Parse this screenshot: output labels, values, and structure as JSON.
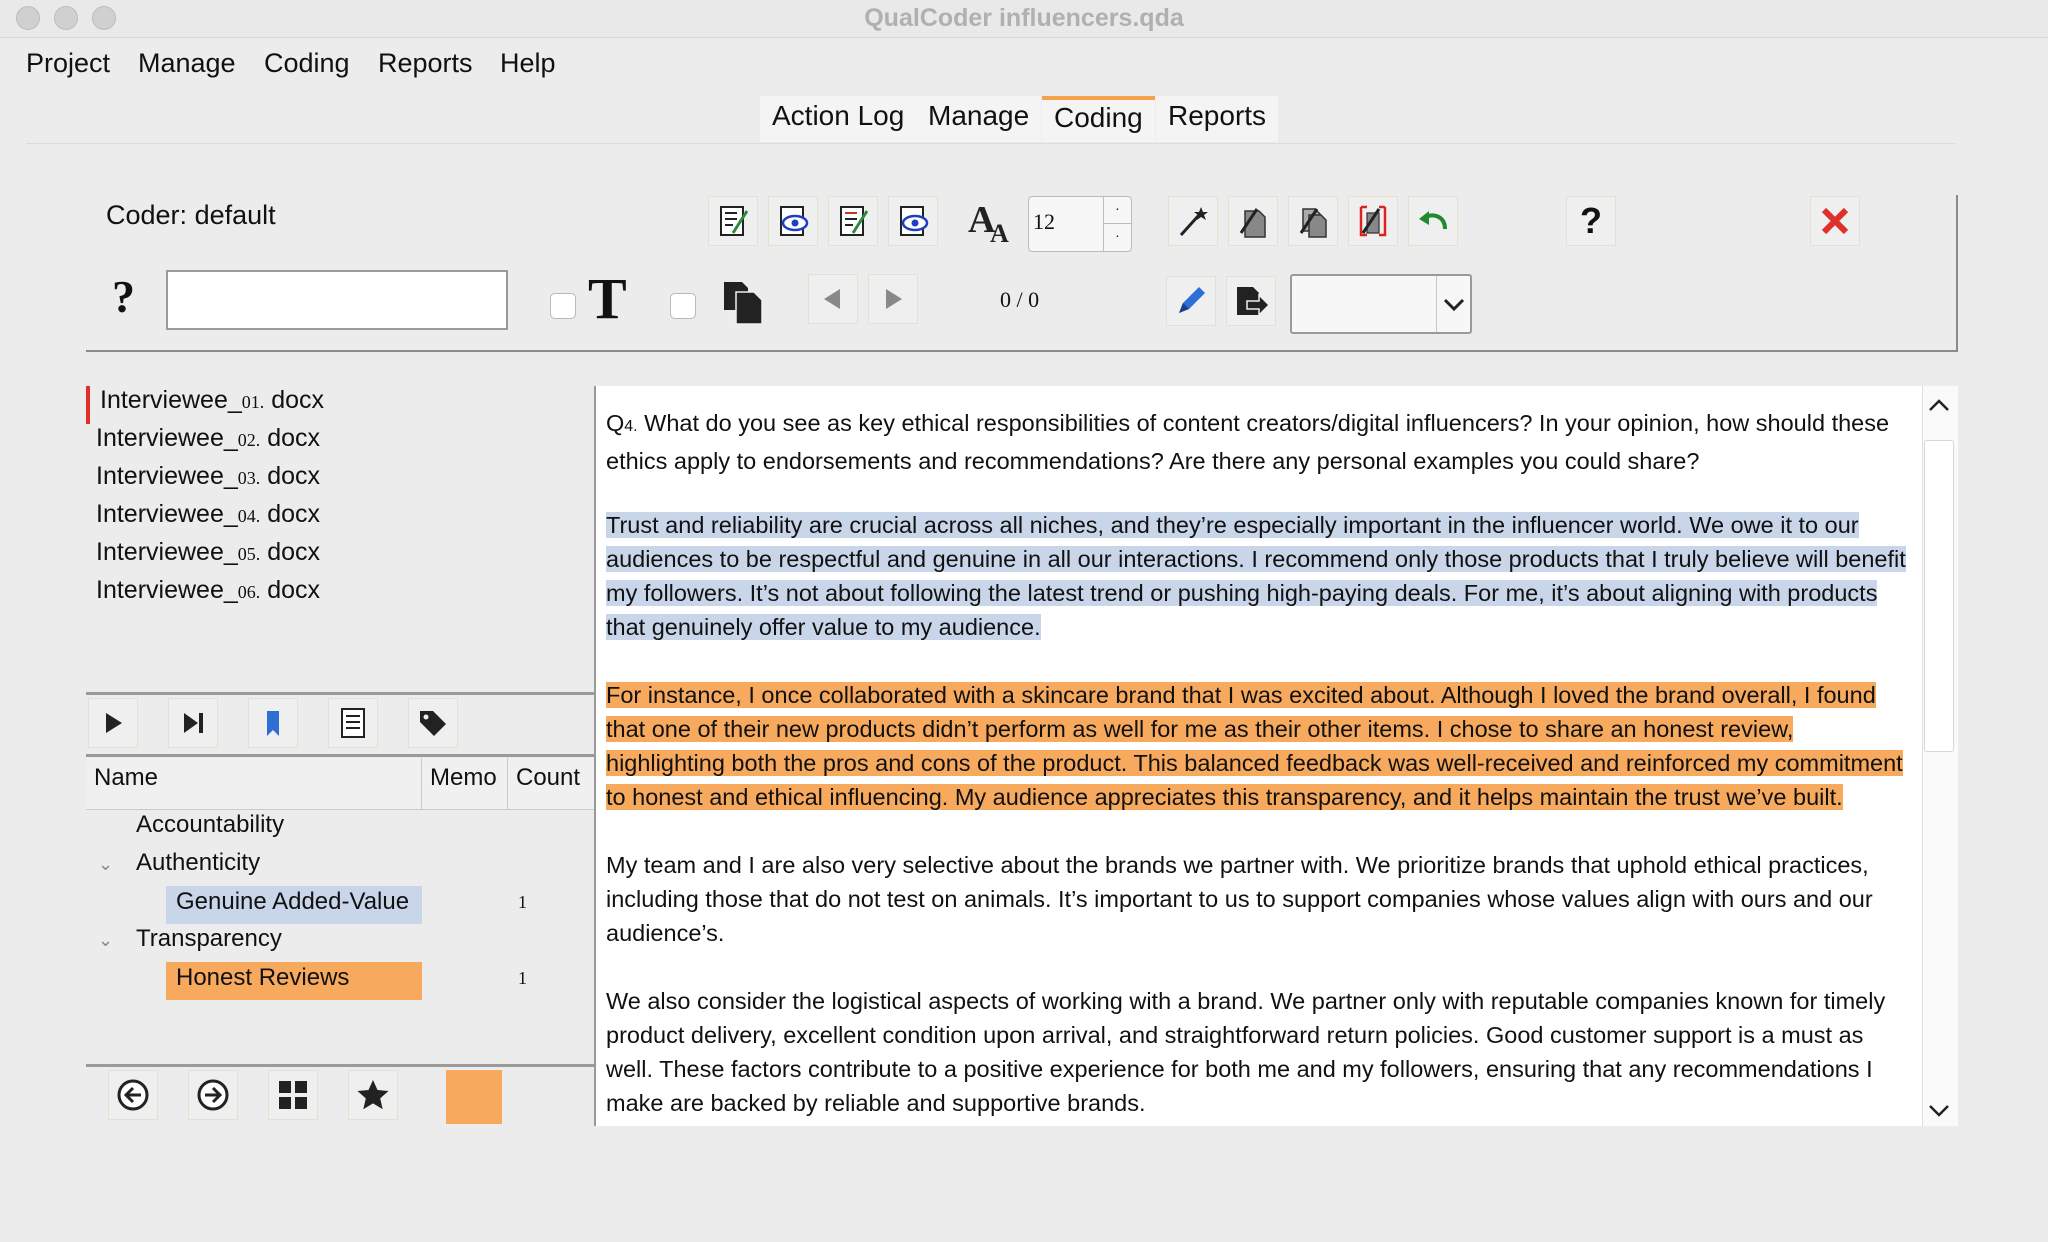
{
  "window": {
    "title": "QualCoder influencers.qda"
  },
  "menu": {
    "items": [
      "Project",
      "Manage",
      "Coding",
      "Reports",
      "Help"
    ]
  },
  "tabs": {
    "items": [
      {
        "label": "Action Log",
        "active": false
      },
      {
        "label": "Manage",
        "active": false
      },
      {
        "label": "Coding",
        "active": true
      },
      {
        "label": "Reports",
        "active": false
      }
    ]
  },
  "toolbar": {
    "coder_label": "Coder:",
    "coder_name": "default",
    "font_size": "12",
    "search_value": "",
    "search_help": "?",
    "help_label": "?",
    "page_counter": "0 / 0",
    "dropdown_value": "",
    "bold_t_label": "T"
  },
  "documents": {
    "items": [
      {
        "prefix": "Interviewee_",
        "num": "01.",
        "suffix": " docx"
      },
      {
        "prefix": "Interviewee_",
        "num": "02.",
        "suffix": " docx"
      },
      {
        "prefix": "Interviewee_",
        "num": "03.",
        "suffix": " docx"
      },
      {
        "prefix": "Interviewee_",
        "num": "04.",
        "suffix": " docx"
      },
      {
        "prefix": "Interviewee_",
        "num": "05.",
        "suffix": " docx"
      },
      {
        "prefix": "Interviewee_",
        "num": "06.",
        "suffix": " docx"
      }
    ]
  },
  "codes_tree": {
    "headers": {
      "name": "Name",
      "memo": "Memo",
      "count": "Count"
    },
    "rows": [
      {
        "name": "Accountability",
        "level": 0,
        "expandable": false,
        "count": ""
      },
      {
        "name": "Authenticity",
        "level": 0,
        "expandable": true,
        "count": ""
      },
      {
        "name": "Genuine Added-Value",
        "level": 1,
        "expandable": false,
        "count": "1",
        "color": "#c9d6ea"
      },
      {
        "name": "Transparency",
        "level": 0,
        "expandable": true,
        "count": ""
      },
      {
        "name": "Honest Reviews",
        "level": 1,
        "expandable": false,
        "count": "1",
        "color": "#f7aa5e"
      }
    ]
  },
  "colors": {
    "accent": "#f5a24a",
    "code_blue": "#c9d6ea",
    "code_orange": "#f7aa5e",
    "close_red": "#e0302a",
    "bookmark_blue": "#2e6fd6"
  },
  "text": {
    "q_prefix": "Q",
    "q_num": "4.",
    "q_body": "  What do you see as key ethical responsibilities of content creators/digital influencers? In your opinion, how should these ethics apply to endorsements and recommendations? Are there any personal examples you could share?",
    "p1": "Trust and reliability are crucial across all niches, and they’re especially important in the influencer world.  We owe it to our audiences to be respectful and genuine in all our interactions.  I recommend only those products that I truly believe will benefit my followers.  It’s not about following the latest trend or pushing high-paying deals.  For me, it’s about aligning with products that genuinely offer value to my audience.",
    "p2": "For instance, I once collaborated with a skincare brand that I was excited about.  Although I loved the brand overall, I found that one of their new products didn’t perform as well for me as their other items.  I chose to share an honest review, highlighting both the pros and cons of the product.  This balanced feedback was well-received and reinforced my commitment to honest and ethical influencing.  My audience appreciates this transparency, and it helps maintain the trust we’ve built.",
    "p3": "My team and I are also very selective about the brands we partner with.  We prioritize brands that uphold ethical practices, including those that do not test on animals.  It’s important to us to support companies whose values align with ours and our audience’s.",
    "p4": "We also consider the logistical aspects of working with a brand.  We partner only with reputable companies known for timely product delivery, excellent condition upon arrival, and straightforward return policies.  Good customer support is a must as well.  These factors contribute to a positive experience for both me and my followers, ensuring that any recommendations I make are backed by reliable and supportive brands."
  }
}
